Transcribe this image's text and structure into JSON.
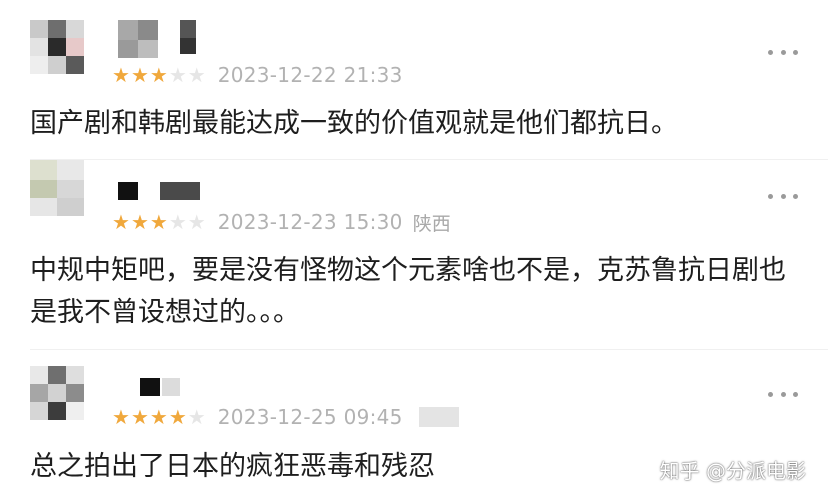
{
  "comments": [
    {
      "rating": 3,
      "max_rating": 5,
      "date": "2023-12-22 21:33",
      "location": "",
      "text": "国产剧和韩剧最能达成一致的价值观就是他们都抗日。"
    },
    {
      "rating": 3,
      "max_rating": 5,
      "date": "2023-12-23 15:30",
      "location": "陕西",
      "text": "中规中矩吧，要是没有怪物这个元素啥也不是，克苏鲁抗日剧也是我不曾设想过的。。。"
    },
    {
      "rating": 4,
      "max_rating": 5,
      "date": "2023-12-25 09:45",
      "location": "",
      "text": "总之拍出了日本的疯狂恶毒和残忍"
    }
  ],
  "icons": {
    "more": "more-dots-icon",
    "star": "star-icon",
    "watermark_logo": "zhihu-logo"
  },
  "colors": {
    "star_on": "#f0a83c",
    "star_off": "#e6e6e6",
    "meta_text": "#b2b2b2"
  },
  "watermark": {
    "text": "知乎 @分派电影"
  }
}
